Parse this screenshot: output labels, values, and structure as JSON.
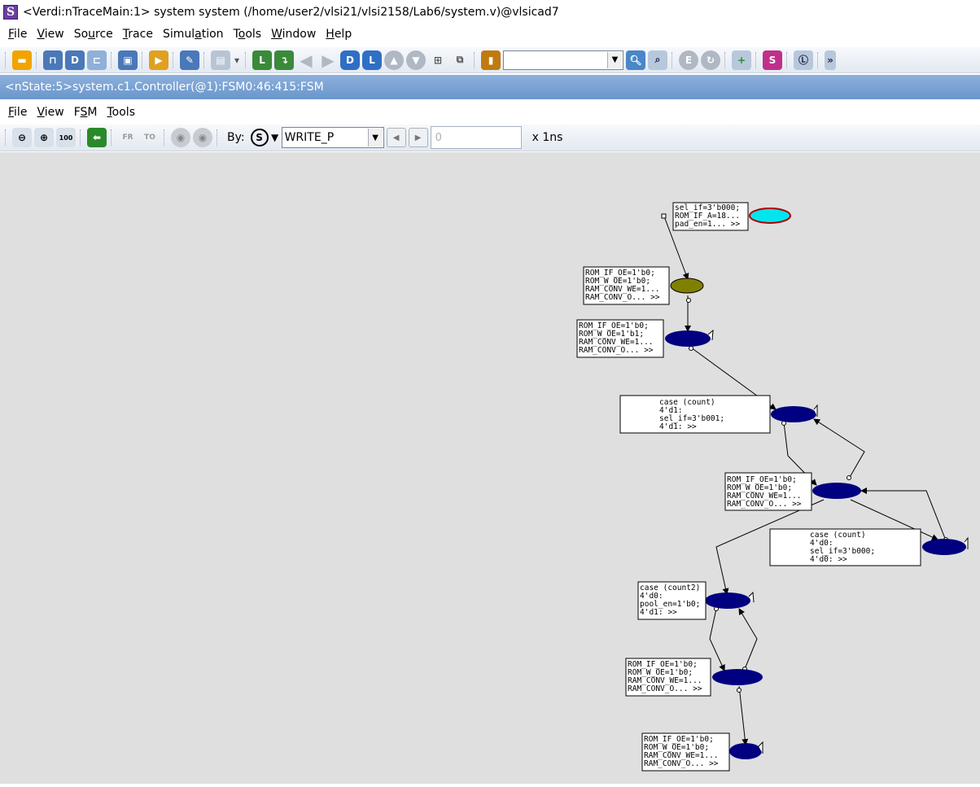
{
  "window": {
    "title": "<Verdi:nTraceMain:1> system system (/home/user2/vlsi21/vlsi2158/Lab6/system.v)@vlsicad7"
  },
  "main_menu": [
    {
      "label": "File",
      "ul": "F"
    },
    {
      "label": "View",
      "ul": "V"
    },
    {
      "label": "Source",
      "ul": "u"
    },
    {
      "label": "Trace",
      "ul": "T"
    },
    {
      "label": "Simulation",
      "ul": "a"
    },
    {
      "label": "Tools",
      "ul": "o"
    },
    {
      "label": "Window",
      "ul": "W"
    },
    {
      "label": "Help",
      "ul": "H"
    }
  ],
  "toolbar1": {
    "search_value": ""
  },
  "state_path": "<nState:5>system.c1.Controller(@1):FSM0:46:415:FSM",
  "fsm_menu": [
    {
      "label": "File",
      "ul": "F"
    },
    {
      "label": "View",
      "ul": "V"
    },
    {
      "label": "FSM",
      "ul": "S"
    },
    {
      "label": "Tools",
      "ul": "T"
    }
  ],
  "fsm_toolbar": {
    "zoom_100": "100",
    "by_label": "By:",
    "state_select": "WRITE_P",
    "time_value": "0",
    "time_unit": "x 1ns"
  },
  "colors": {
    "initial_state": "#808000",
    "reset_state": "#00e5ee",
    "state": "#000080"
  },
  "fsm": {
    "boxes": [
      {
        "lines": [
          "sel_if=3'b000;",
          "ROM_IF_A=18...",
          "pad_en=1... >>"
        ]
      },
      {
        "lines": [
          "ROM_IF_OE=1'b0;",
          "ROM_W_OE=1'b0;",
          "RAM_CONV_WE=1...",
          "RAM_CONV_O... >>"
        ]
      },
      {
        "lines": [
          "ROM_IF_OE=1'b0;",
          "ROM_W_OE=1'b1;",
          "RAM_CONV_WE=1...",
          "RAM_CONV_O... >>"
        ]
      },
      {
        "lines": [
          "case (count)",
          "4'd1:",
          "sel_if=3'b001;",
          "4'd1: >>"
        ]
      },
      {
        "lines": [
          "ROM_IF_OE=1'b0;",
          "ROM_W_OE=1'b0;",
          "RAM_CONV_WE=1...",
          "RAM_CONV_O... >>"
        ]
      },
      {
        "lines": [
          "case (count)",
          "4'd0:",
          "sel_if=3'b000;",
          "4'd0: >>"
        ]
      },
      {
        "lines": [
          "case (count2)",
          "4'd0:",
          "pool_en=1'b0;",
          "4'd1: >>"
        ]
      },
      {
        "lines": [
          "ROM_IF_OE=1'b0;",
          "ROM_W_OE=1'b0;",
          "RAM_CONV_WE=1...",
          "RAM_CONV_O... >>"
        ]
      },
      {
        "lines": [
          "ROM_IF_OE=1'b0;",
          "ROM_W_OE=1'b0;",
          "RAM_CONV_WE=1...",
          "RAM_CONV_O... >>"
        ]
      }
    ]
  }
}
